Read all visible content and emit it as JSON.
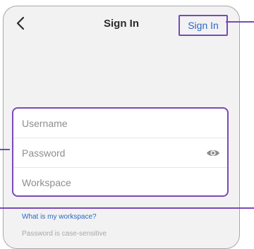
{
  "header": {
    "title": "Sign In",
    "action_label": "Sign In"
  },
  "form": {
    "username_placeholder": "Username",
    "password_placeholder": "Password",
    "workspace_placeholder": "Workspace"
  },
  "links": {
    "workspace_help": "What is my workspace?"
  },
  "hint": "Password is case-sensitive",
  "icons": {
    "back": "chevron-left-icon",
    "password_toggle": "eye-icon"
  },
  "colors": {
    "accent_link": "#2c66c7",
    "highlight": "#7a4ab5",
    "background": "#f2f2f3"
  }
}
